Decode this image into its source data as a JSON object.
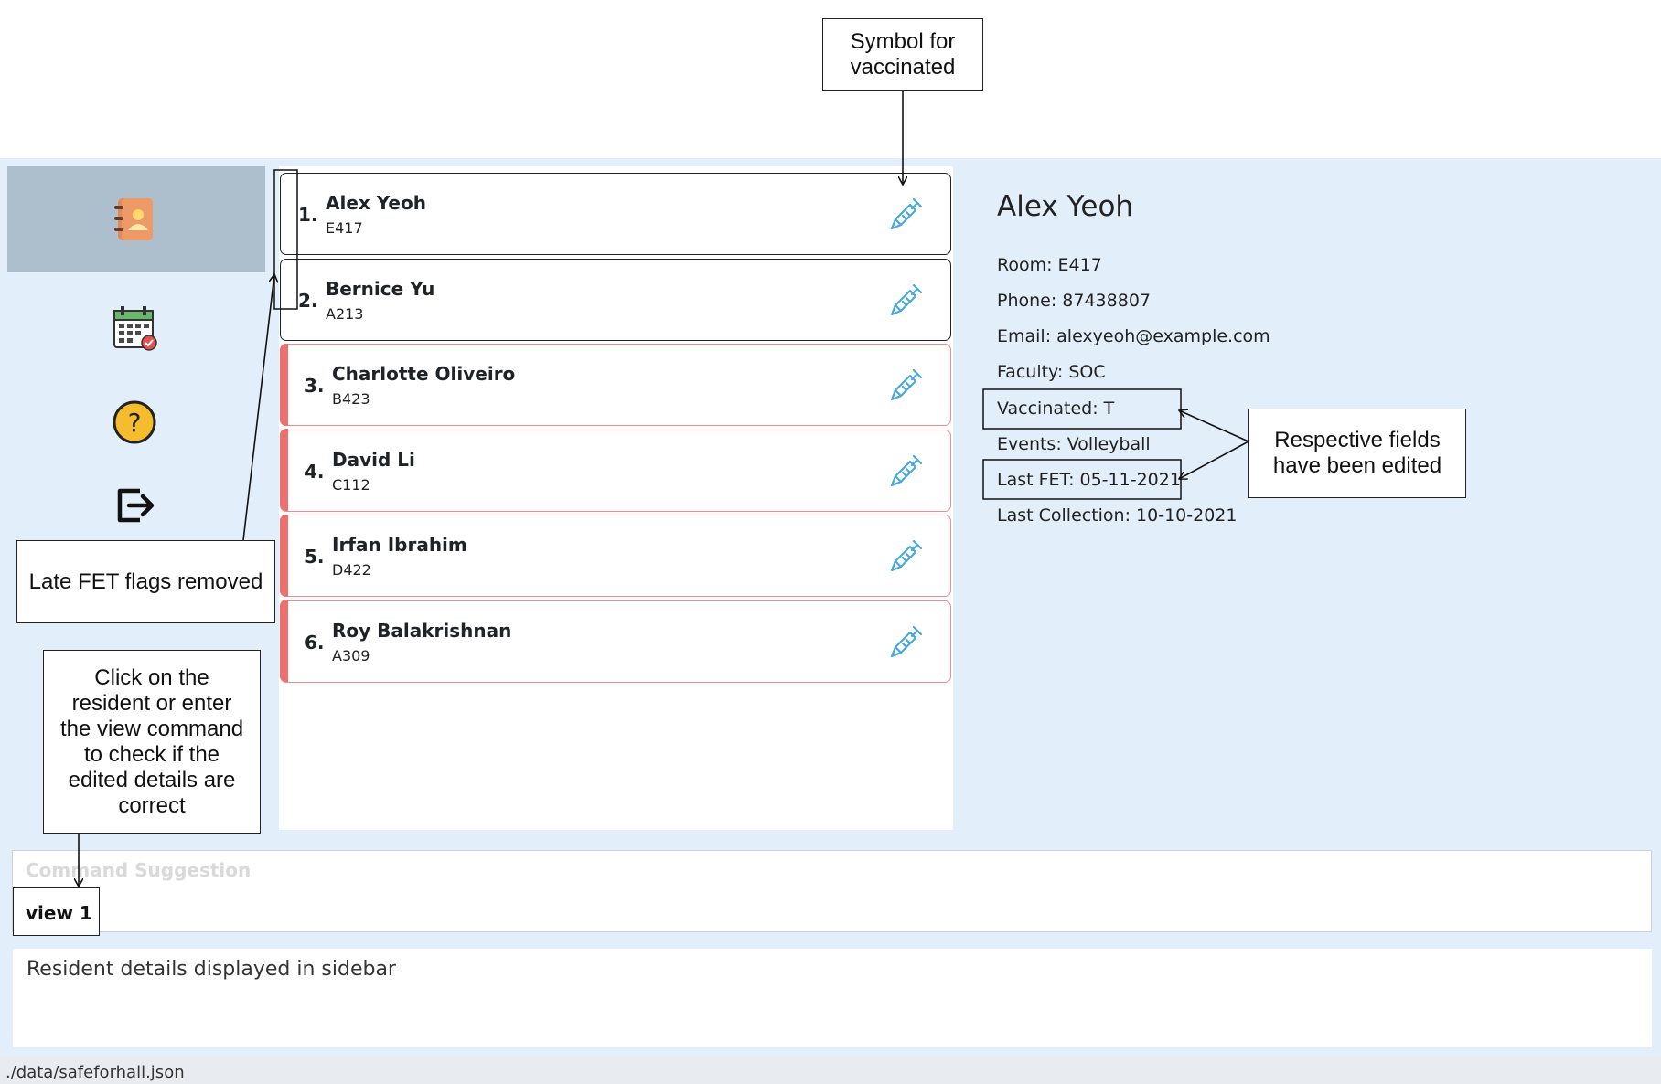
{
  "sidebar": {
    "items": [
      {
        "icon": "address-book-icon",
        "active": true
      },
      {
        "icon": "calendar-icon",
        "active": false
      },
      {
        "icon": "help-icon",
        "active": false
      },
      {
        "icon": "exit-icon",
        "active": false
      }
    ]
  },
  "residents": [
    {
      "index": "1.",
      "name": "Alex Yeoh",
      "room": "E417",
      "flagged": false,
      "vaccinated": true
    },
    {
      "index": "2.",
      "name": "Bernice Yu",
      "room": "A213",
      "flagged": false,
      "vaccinated": true
    },
    {
      "index": "3.",
      "name": "Charlotte Oliveiro",
      "room": "B423",
      "flagged": true,
      "vaccinated": true
    },
    {
      "index": "4.",
      "name": "David Li",
      "room": "C112",
      "flagged": true,
      "vaccinated": true
    },
    {
      "index": "5.",
      "name": "Irfan Ibrahim",
      "room": "D422",
      "flagged": true,
      "vaccinated": true
    },
    {
      "index": "6.",
      "name": "Roy Balakrishnan",
      "room": "A309",
      "flagged": true,
      "vaccinated": true
    }
  ],
  "detail": {
    "name": "Alex Yeoh",
    "fields": [
      "Room: E417",
      "Phone: 87438807",
      "Email: alexyeoh@example.com",
      "Faculty: SOC",
      "Vaccinated: T",
      "Events: Volleyball",
      "Last FET: 05-11-2021",
      "Last Collection: 10-10-2021"
    ]
  },
  "command": {
    "suggestion": "Command Suggestion",
    "input": "view 1"
  },
  "result": "Resident details displayed in sidebar",
  "status": {
    "path": "./data/safeforhall.json"
  },
  "annotations": {
    "vaccinated_symbol": [
      "Symbol for",
      "vaccinated"
    ],
    "edited_fields": [
      "Respective fields",
      "have been edited"
    ],
    "late_fet": "Late FET flags removed",
    "view_hint": [
      "Click on the",
      "resident or enter",
      "the view command",
      "to check if the",
      "edited details are",
      "correct"
    ]
  },
  "colors": {
    "app_bg": "#e3eefb",
    "nav_active": "#adbecd",
    "flag": "#ef6f6f",
    "syringe": "#4aa8d8"
  }
}
